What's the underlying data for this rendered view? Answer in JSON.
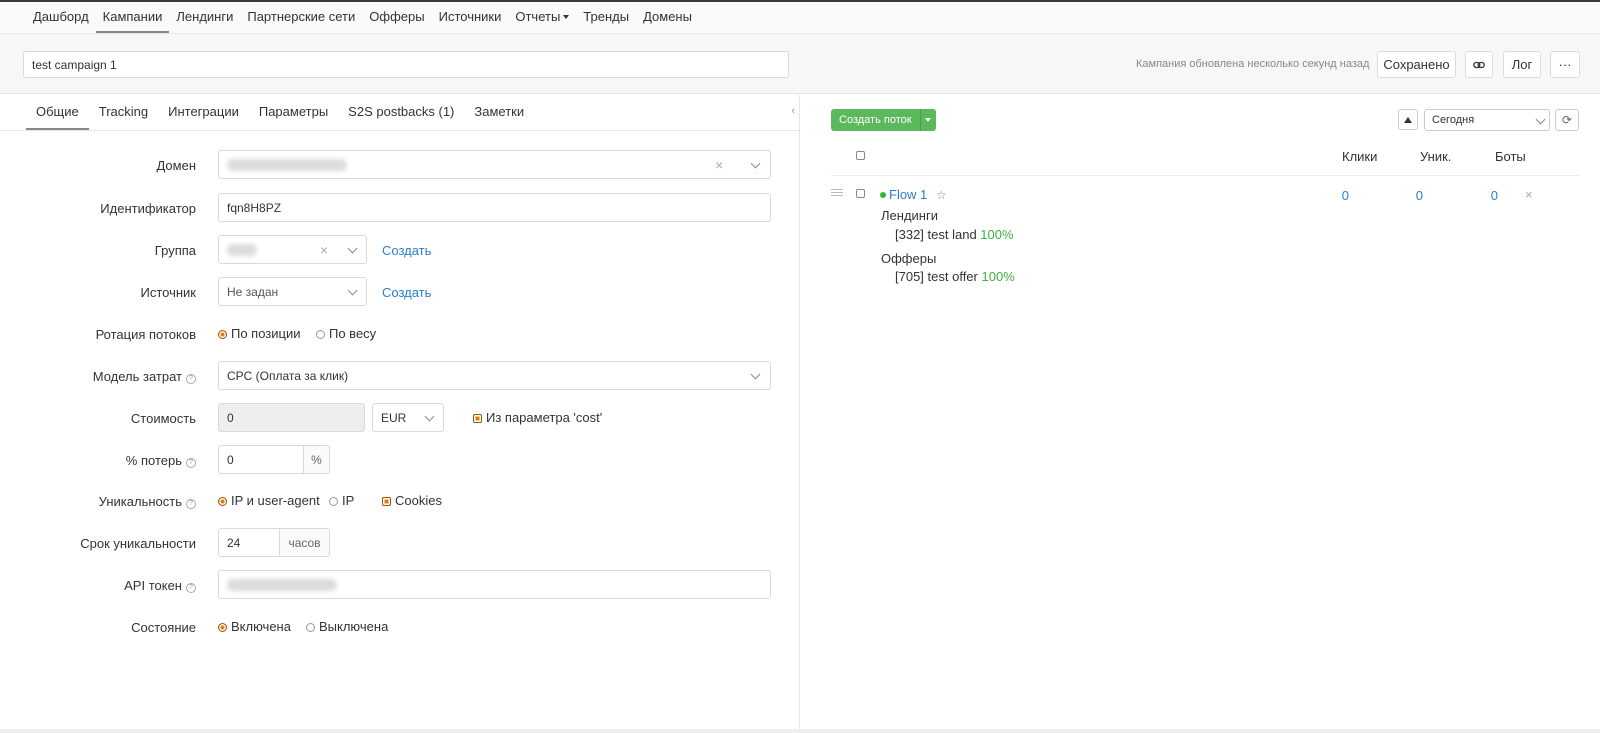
{
  "nav": {
    "items": [
      "Дашборд",
      "Кампании",
      "Лендинги",
      "Партнерские сети",
      "Офферы",
      "Источники",
      "Отчеты",
      "Тренды",
      "Домены"
    ],
    "active_index": 1
  },
  "header": {
    "campaign_name": "test campaign 1",
    "updated_text": "Кампания обновлена несколько секунд назад",
    "saved_label": "Сохранено",
    "link_icon": "link-icon",
    "log_label": "Лог",
    "more_label": "···"
  },
  "tabs": [
    "Общие",
    "Tracking",
    "Интеграции",
    "Параметры",
    "S2S postbacks (1)",
    "Заметки"
  ],
  "form": {
    "domain_label": "Домен",
    "identifier_label": "Идентификатор",
    "identifier_value": "fqn8H8PZ",
    "group_label": "Группа",
    "create_link": "Создать",
    "source_label": "Источник",
    "source_value": "Не задан",
    "rotation_label": "Ротация потоков",
    "rotation_opt1": "По позиции",
    "rotation_opt2": "По весу",
    "cost_model_label": "Модель затрат",
    "cost_model_value": "CPC (Оплата за клик)",
    "cost_label": "Стоимость",
    "cost_value": "0",
    "currency_value": "EUR",
    "cost_param_label": "Из параметра 'cost'",
    "loss_label": "% потерь",
    "loss_value": "0",
    "loss_unit": "%",
    "uniq_label": "Уникальность",
    "uniq_opt1": "IP и user-agent",
    "uniq_opt2": "IP",
    "uniq_cookies": "Cookies",
    "uniq_period_label": "Срок уникальности",
    "uniq_period_value": "24",
    "uniq_period_unit": "часов",
    "api_label": "API токен",
    "state_label": "Состояние",
    "state_on": "Включена",
    "state_off": "Выключена"
  },
  "flows": {
    "create_btn": "Создать поток",
    "date_range": "Сегодня",
    "col_clicks": "Клики",
    "col_unique": "Уник.",
    "col_bots": "Боты",
    "flow_name": "Flow 1",
    "clicks": "0",
    "unique": "0",
    "bots": "0",
    "landings_title": "Лендинги",
    "landing_item": "[332] test land",
    "landing_pct": "100%",
    "offers_title": "Офферы",
    "offer_item": "[705] test offer",
    "offer_pct": "100%"
  },
  "colors": {
    "accent_orange": "#e07a10",
    "green": "#5cb85c",
    "link_blue": "#2a7fc9"
  }
}
